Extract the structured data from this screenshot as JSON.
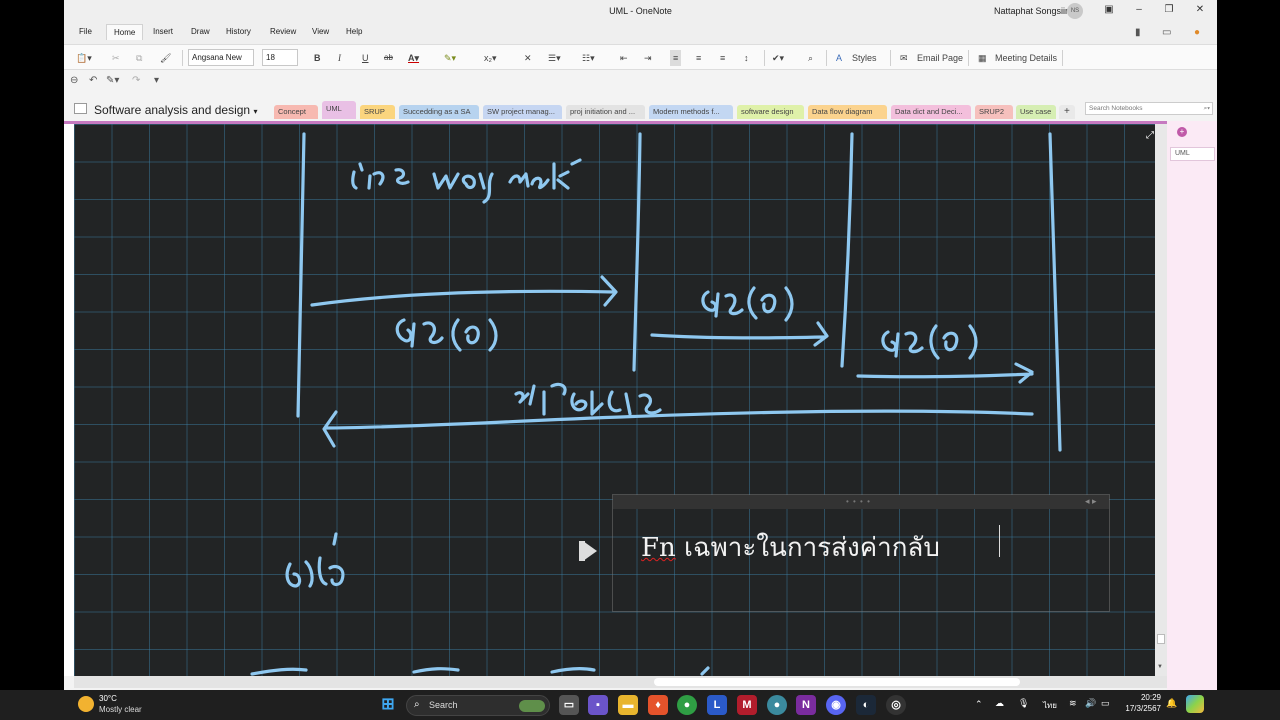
{
  "window": {
    "title": "UML - OneNote",
    "user_name": "Nattaphat Songsiin",
    "user_initials": "NS"
  },
  "menu": {
    "tabs": [
      "File",
      "Home",
      "Insert",
      "Draw",
      "History",
      "Review",
      "View",
      "Help"
    ],
    "active_tab": "Home"
  },
  "ribbon": {
    "font_name": "Angsana New",
    "font_size": "18",
    "bold": "B",
    "italic": "I",
    "underline": "U",
    "strike": "ab",
    "styles": "Styles",
    "email_page": "Email Page",
    "meeting_details": "Meeting Details"
  },
  "notebook": {
    "title": "Software analysis and design",
    "search_placeholder": "Search Notebooks",
    "sections": [
      {
        "label": "Concept",
        "color": "#f7b9b1"
      },
      {
        "label": "UML",
        "color": "#e9c0e5"
      },
      {
        "label": "SRUP",
        "color": "#fbd57e"
      },
      {
        "label": "Succedding as a SA",
        "color": "#b7d3ef"
      },
      {
        "label": "SW project manag...",
        "color": "#c6d6f2"
      },
      {
        "label": "proj initiation and ...",
        "color": "#e3e3e3"
      },
      {
        "label": "Modern methods f...",
        "color": "#c3d7f2"
      },
      {
        "label": "software design",
        "color": "#dff1a9"
      },
      {
        "label": "Data flow diagram",
        "color": "#fbd38e"
      },
      {
        "label": "Data dict and Deci...",
        "color": "#f3bfdc"
      },
      {
        "label": "SRUP2",
        "color": "#f6c0bd"
      },
      {
        "label": "Use case",
        "color": "#d6eeb3"
      }
    ],
    "active_section": "UML",
    "add_section": "+"
  },
  "page_list": {
    "add_page": "+",
    "pages": [
      "UML"
    ]
  },
  "note": {
    "text_fn": "Fn",
    "text_rest": " เฉพาะในการส่งค่ากลับ"
  },
  "colors": {
    "canvas": "#222425",
    "ink": "#8fc8f0",
    "accent": "#c05aa8"
  },
  "taskbar": {
    "temperature": "30°C",
    "condition": "Mostly clear",
    "search_label": "Search",
    "language": "ไทย",
    "time": "20:29",
    "date": "17/3/2567"
  }
}
